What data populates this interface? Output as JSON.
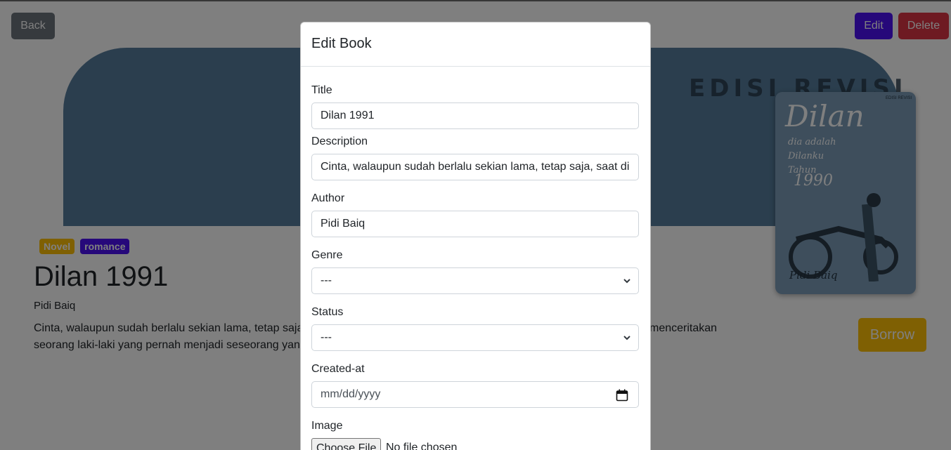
{
  "page": {
    "back_label": "Back",
    "edit_label": "Edit",
    "delete_label": "Delete",
    "borrow_label": "Borrow",
    "banner_text": "EDISI REVISI",
    "book": {
      "genre_badge": "Novel",
      "tag_badge": "romance",
      "title": "Dilan 1991",
      "author": "Pidi Baiq",
      "description_left": "Cinta, walaupun sudah berlalu sekian lama, tetap saja",
      "description_right": "menceritakan",
      "description_line2": "seorang laki-laki yang pernah menjadi seseorang yan"
    },
    "cover": {
      "title": "Dilan",
      "subtitle": "dia adalah Dilanku Tahun",
      "year": "1990",
      "author": "Pidi Baiq",
      "edition": "EDISI REVISI"
    }
  },
  "modal": {
    "title": "Edit Book",
    "fields": {
      "title_label": "Title",
      "title_value": "Dilan 1991",
      "description_label": "Description",
      "description_value": "Cinta, walaupun sudah berlalu sekian lama, tetap saja, saat di",
      "author_label": "Author",
      "author_value": "Pidi Baiq",
      "genre_label": "Genre",
      "genre_value": "---",
      "status_label": "Status",
      "status_value": "---",
      "created_label": "Created-at",
      "created_placeholder": "mm/dd/yyyy",
      "image_label": "Image",
      "file_button": "Choose File",
      "file_status": "No file chosen"
    }
  },
  "colors": {
    "primary": "#4c10f5",
    "danger": "#dc3545",
    "warning": "#ffc107",
    "secondary": "#6c757d"
  }
}
